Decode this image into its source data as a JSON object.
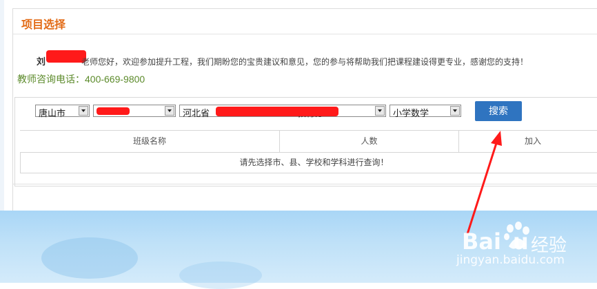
{
  "panel": {
    "title": "项目选择",
    "teacher_name_visible": "刘",
    "welcome_text": "老师您好，欢迎参加提升工程，我们期盼您的宝贵建议和意见，您的参与将帮助我们把课程建设得更专业，感谢您的支持！",
    "phone_text": "教师咨询电话：400-669-9800"
  },
  "filters": {
    "city": "唐山市",
    "county": "",
    "school_prefix": "河北省",
    "school_suffix": "教育办",
    "subject": "小学数学",
    "search_label": "搜索"
  },
  "table": {
    "columns": [
      "班级名称",
      "人数",
      "加入"
    ],
    "empty_message": "请先选择市、县、学校和学科进行查询！"
  },
  "watermark": {
    "brand": "Bai",
    "brand_tail": "u",
    "product": "经验",
    "url": "jingyan.baidu.com"
  },
  "colors": {
    "title": "#e26a15",
    "phone": "#5b8a2a",
    "button": "#2f74c0",
    "annotation": "#ff1a1a"
  }
}
